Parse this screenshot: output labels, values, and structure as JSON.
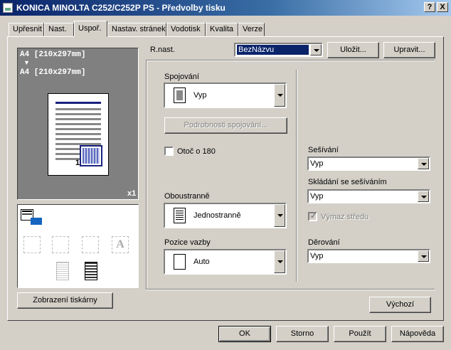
{
  "window": {
    "title": "KONICA MINOLTA C252/C252P PS - Předvolby tisku",
    "help_btn": "?",
    "close_btn": "X"
  },
  "tabs": [
    "Upřesnit",
    "Nast.",
    "Uspoř.",
    "Nastav. stránek",
    "Vodotisk",
    "Kvalita",
    "Verze"
  ],
  "active_tab": "Uspoř.",
  "preview": {
    "paper_line1": "A4 [210x297mm]",
    "arrow": "▼",
    "paper_line2": "A4 [210x297mm]",
    "copies": "x1",
    "page_number": "1",
    "printer_view_button": "Zobrazení tiskárny"
  },
  "favorites": {
    "label": "R.nast.",
    "value": "BezNázvu",
    "save_button": "Uložit...",
    "edit_button": "Upravit..."
  },
  "combination": {
    "label": "Spojování",
    "value": "Vyp",
    "details_button": "Podrobnosti spojování..."
  },
  "rotate": {
    "label": "Otoč o 180",
    "checked": false
  },
  "duplex": {
    "label": "Oboustranně",
    "value": "Jednostranně"
  },
  "binding": {
    "label": "Pozice vazby",
    "value": "Auto"
  },
  "staple": {
    "label": "Sešívání",
    "value": "Vyp"
  },
  "fold_staple": {
    "label": "Skládání se sešíváním",
    "value": "Vyp"
  },
  "center_erase": {
    "label": "Výmaz středu",
    "checked": true,
    "disabled": true
  },
  "punch": {
    "label": "Děrování",
    "value": "Vyp"
  },
  "default_button": "Výchozí",
  "footer": {
    "ok": "OK",
    "cancel": "Storno",
    "apply": "Použít",
    "help": "Nápověda"
  }
}
